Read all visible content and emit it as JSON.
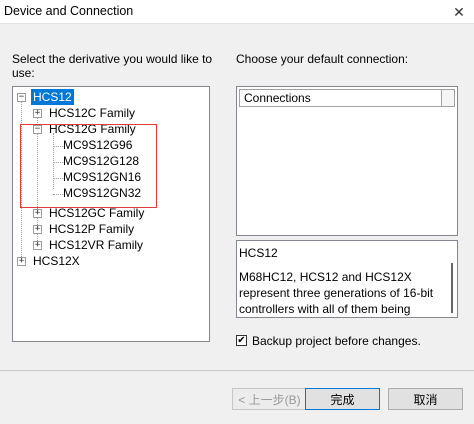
{
  "window": {
    "title": "Device and Connection",
    "close_glyph": "✕"
  },
  "left": {
    "prompt_line1": "Select the derivative you would like to",
    "prompt_line2": "use:",
    "tree": {
      "root": "HCS12",
      "hcs12c": "HCS12C Family",
      "hcs12g": "HCS12G Family",
      "g96": "MC9S12G96",
      "g128": "MC9S12G128",
      "gn16": "MC9S12GN16",
      "gn32": "MC9S12GN32",
      "hcs12gc": "HCS12GC Family",
      "hcs12p": "HCS12P Family",
      "hcs12vr": "HCS12VR Family",
      "hcs12x": "HCS12X"
    },
    "expand_glyphs": {
      "expanded": "−",
      "collapsed": "+"
    }
  },
  "right": {
    "prompt": "Choose your default connection:",
    "connections_header": "Connections",
    "description": {
      "title": "HCS12",
      "body": "M68HC12, HCS12 and HCS12X represent three generations of 16-bit controllers with all of them being derived from the"
    },
    "backup_label": "Backup project before changes.",
    "backup_check": "✔"
  },
  "buttons": {
    "back": "< 上一步(B)",
    "finish": "完成",
    "cancel": "取消"
  },
  "colors": {
    "selection": "#0078d7",
    "highlight_box": "#e03a3a"
  }
}
